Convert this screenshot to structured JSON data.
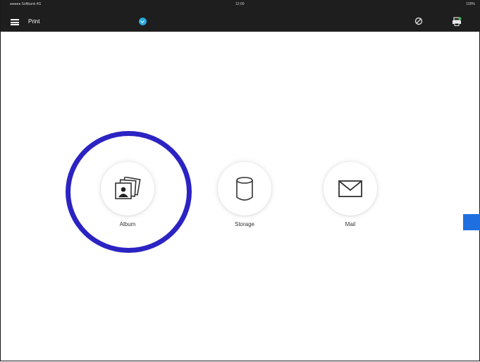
{
  "status_bar": {
    "carrier": "●●●●● Softbank  4G",
    "time": "12:00",
    "battery": "100%"
  },
  "top_bar": {
    "title": "Print",
    "background": "#1e1e1e",
    "icons": [
      "menu-icon",
      "bluetooth-icon",
      "nfc-icon",
      "printer-settings-icon"
    ],
    "bluetooth_color": "#2aa9e0"
  },
  "sources": [
    {
      "label": "Album",
      "icon": "photo-album-icon"
    },
    {
      "label": "Storage",
      "icon": "storage-cylinder-icon"
    },
    {
      "label": "Mail",
      "icon": "mail-envelope-icon"
    }
  ],
  "annotation": {
    "highlight_color": "#2b23c2",
    "marker_color": "#1f6fe0"
  }
}
